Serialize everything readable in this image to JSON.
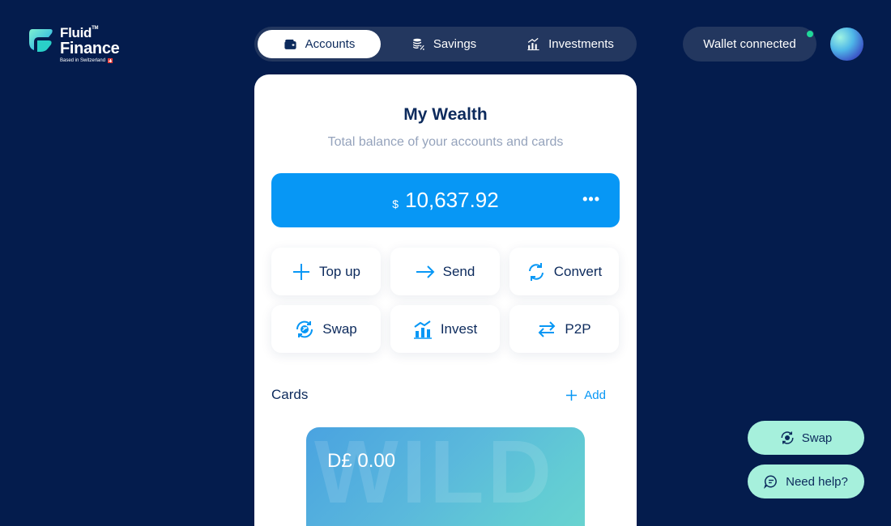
{
  "brand": {
    "name_line1": "Fluid",
    "trademark": "TM",
    "name_line2": "Finance",
    "tagline": "Based in Switzerland",
    "logo_icon": "fluid-logo-icon"
  },
  "nav": {
    "tabs": [
      {
        "label": "Accounts",
        "icon": "wallet-icon",
        "active": true
      },
      {
        "label": "Savings",
        "icon": "coins-percent-icon",
        "active": false
      },
      {
        "label": "Investments",
        "icon": "bar-chart-icon",
        "active": false
      }
    ]
  },
  "wallet": {
    "label": "Wallet connected",
    "status_color": "#1fd89a"
  },
  "main": {
    "title": "My Wealth",
    "subtitle": "Total balance of your accounts and cards",
    "balance": {
      "currency": "$",
      "amount": "10,637.92",
      "more_icon": "more-horizontal-icon"
    },
    "actions": [
      {
        "label": "Top up",
        "icon": "plus-icon"
      },
      {
        "label": "Send",
        "icon": "arrow-right-icon"
      },
      {
        "label": "Convert",
        "icon": "refresh-icon"
      },
      {
        "label": "Swap",
        "icon": "swap-circle-icon"
      },
      {
        "label": "Invest",
        "icon": "invest-chart-icon"
      },
      {
        "label": "P2P",
        "icon": "transfer-arrows-icon"
      }
    ],
    "cards_label": "Cards",
    "add_label": "Add",
    "card": {
      "balance": "D£ 0.00",
      "watermark": "WILD CARD"
    }
  },
  "floating": {
    "swap_label": "Swap",
    "help_label": "Need help?"
  },
  "colors": {
    "background": "#041c4d",
    "accent": "#0797f5",
    "mint": "#a6f0dc",
    "text_dark": "#0c2a5c"
  }
}
